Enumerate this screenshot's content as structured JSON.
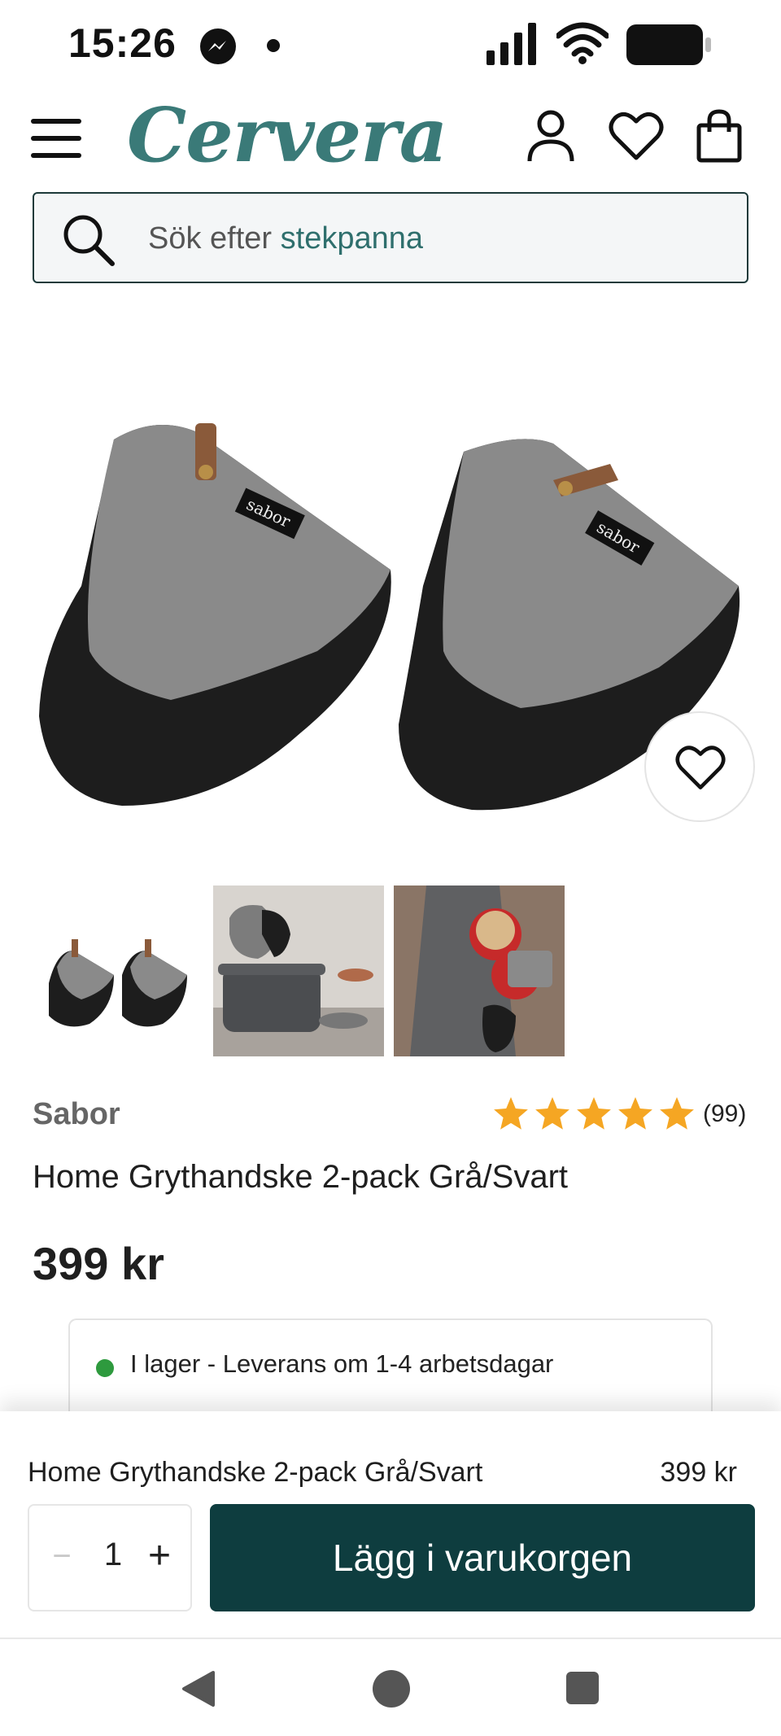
{
  "status_bar": {
    "time": "15:26"
  },
  "header": {
    "logo_text": "Cervera"
  },
  "search": {
    "prefix": "Sök efter ",
    "suggestion": "stekpanna"
  },
  "product": {
    "brand": "Sabor",
    "rating_stars": 5,
    "rating_count": "(99)",
    "title": "Home Grythandske 2-pack Grå/Svart",
    "price": "399 kr",
    "stock_text": "I lager - Leverans om 1-4 arbetsdagar",
    "label_on_mitts": "sabor"
  },
  "buy_bar": {
    "title": "Home Grythandske 2-pack Grå/Svart",
    "price": "399 kr",
    "qty_minus": "−",
    "qty_value": "1",
    "qty_plus": "+",
    "add_to_cart": "Lägg i varukorgen"
  },
  "colors": {
    "brand_teal": "#3a7a78",
    "button_dark": "#0e3d3f",
    "star": "#f5a623",
    "in_stock": "#2e9a3e"
  }
}
